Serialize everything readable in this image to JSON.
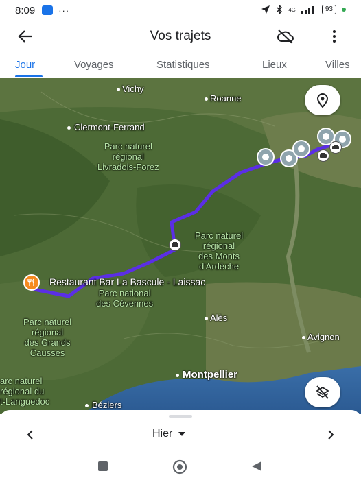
{
  "status_bar": {
    "time": "8:09",
    "dots": "···",
    "battery": "93",
    "signal_text": "4G"
  },
  "app_bar": {
    "title": "Vos trajets"
  },
  "tabs": [
    {
      "label": "Jour",
      "active": true
    },
    {
      "label": "Voyages",
      "active": false
    },
    {
      "label": "Statistiques",
      "active": false
    },
    {
      "label": "Lieux",
      "active": false
    },
    {
      "label": "Villes",
      "active": false
    }
  ],
  "map": {
    "cities": {
      "vichy": "Vichy",
      "roanne": "Roanne",
      "clermont": "Clermont-Ferrand",
      "ales": "Alès",
      "avignon": "Avignon",
      "montpellier": "Montpellier",
      "beziers": "Béziers"
    },
    "parks": {
      "livradois_1": "Parc naturel",
      "livradois_2": "régional",
      "livradois_3": "Livradois-Forez",
      "ardeche_1": "Parc naturel",
      "ardeche_2": "régional",
      "ardeche_3": "des Monts",
      "ardeche_4": "d'Ardèche",
      "cevennes_1": "Parc national",
      "cevennes_2": "des Cévennes",
      "causses_1": "Parc naturel",
      "causses_2": "régional",
      "causses_3": "des Grands",
      "causses_4": "Causses",
      "languedoc_1": "arc naturel",
      "languedoc_2": "régional du",
      "languedoc_3": "t-Languedoc"
    },
    "restaurant_label": "Restaurant Bar La Bascule - Laissac",
    "colors": {
      "route": "#5b2ee6",
      "restaurant_pin": "#f58a1f",
      "accent": "#1a73e8"
    }
  },
  "bottom_sheet": {
    "date_label": "Hier"
  }
}
